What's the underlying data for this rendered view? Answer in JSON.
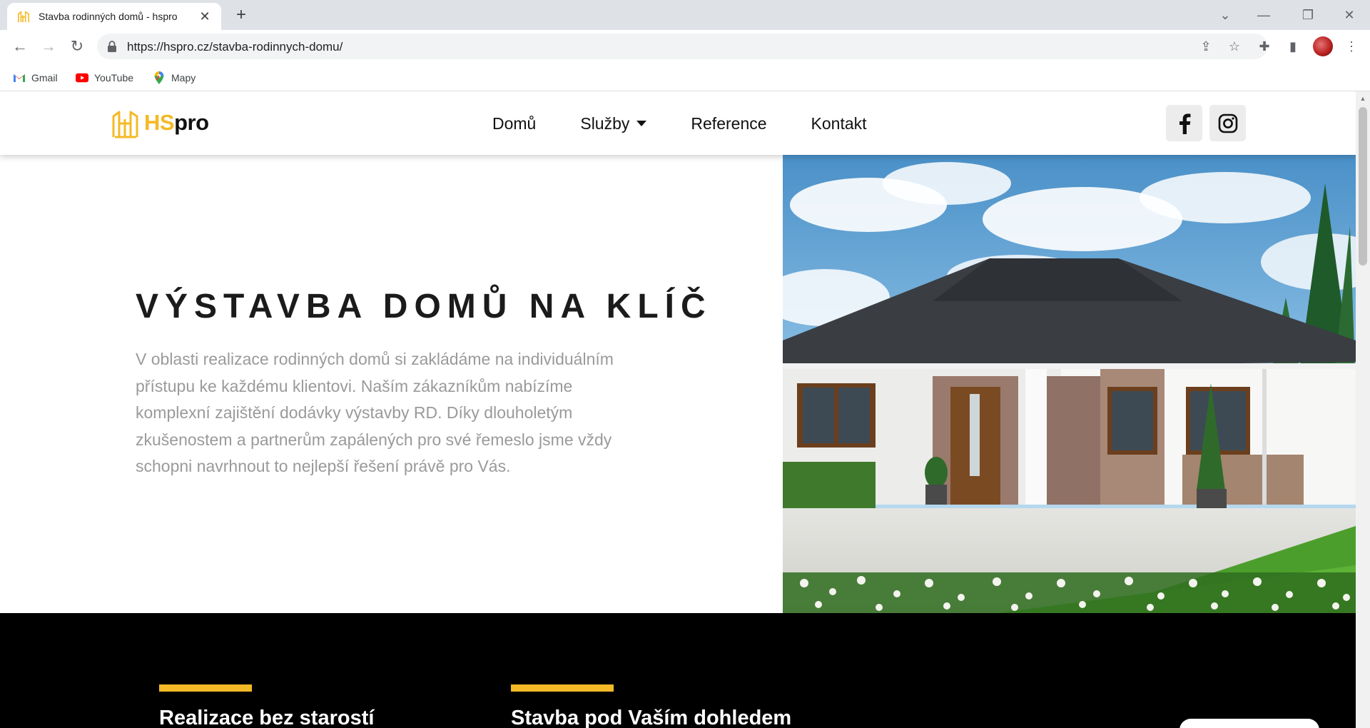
{
  "browser": {
    "tab": {
      "title": "Stavba rodinných domů - hspro",
      "close": "✕"
    },
    "new_tab": "+",
    "window_controls": {
      "dropdown": "⌄",
      "minimize": "—",
      "restore": "❐",
      "close": "✕"
    },
    "nav": {
      "back": "←",
      "forward": "→",
      "reload": "↻"
    },
    "url": "https://hspro.cz/stavba-rodinnych-domu/",
    "bookmarks": [
      {
        "label": "Gmail",
        "icon": "gmail-icon"
      },
      {
        "label": "YouTube",
        "icon": "youtube-icon"
      },
      {
        "label": "Mapy",
        "icon": "maps-icon"
      }
    ]
  },
  "site": {
    "logo": {
      "hs": "HS",
      "pro": "pro"
    },
    "nav": [
      {
        "label": "Domů"
      },
      {
        "label": "Služby",
        "has_dropdown": true
      },
      {
        "label": "Reference"
      },
      {
        "label": "Kontakt"
      }
    ],
    "social": [
      {
        "icon": "facebook-icon",
        "glyph": "f"
      },
      {
        "icon": "instagram-icon"
      }
    ],
    "hero": {
      "title": "VÝSTAVBA DOMŮ NA KLÍČ",
      "text": "V oblasti realizace rodinných domů si zakládáme na individuálním přístupu ke každému klientovi. Naším zákazníkům nabízíme komplexní zajištění dodávky výstavby RD. Díky dlouholetým zkušenostem a partnerům zapálených pro své řemeslo jsme vždy schopni navrhnout to nejlepší řešení právě pro Vás."
    },
    "features": [
      {
        "title": "Realizace bez starostí"
      },
      {
        "title": "Stavba pod Vaším dohledem"
      }
    ]
  },
  "colors": {
    "accent": "#f4b926",
    "dark_section": "#000000",
    "hero_text": "#9a9a9a"
  }
}
